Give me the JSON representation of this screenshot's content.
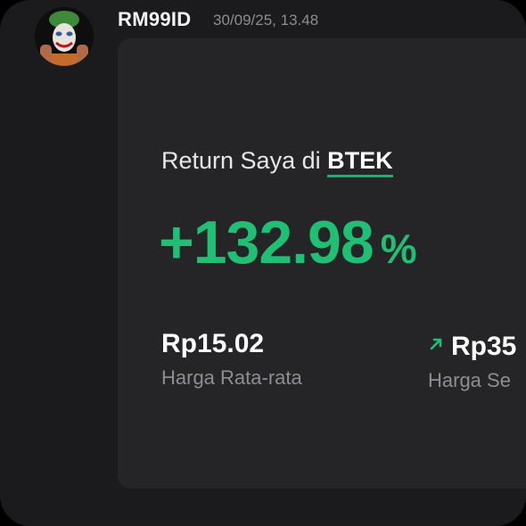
{
  "message": {
    "username": "RM99ID",
    "timestamp": "30/09/25, 13.48",
    "avatar_icon": "joker-avatar"
  },
  "card": {
    "title_prefix": "Return Saya di",
    "ticker": "BTEK",
    "return_value": "+132.98",
    "return_unit": "%",
    "stats": [
      {
        "value": "Rp15.02",
        "label": "Harga Rata-rata"
      },
      {
        "value": "Rp35",
        "label": "Harga Se",
        "icon": "arrow-up-right-icon"
      }
    ]
  },
  "colors": {
    "accent_green": "#1fbf74",
    "card_background": "#252527",
    "frame_background": "#1b1b1d"
  }
}
